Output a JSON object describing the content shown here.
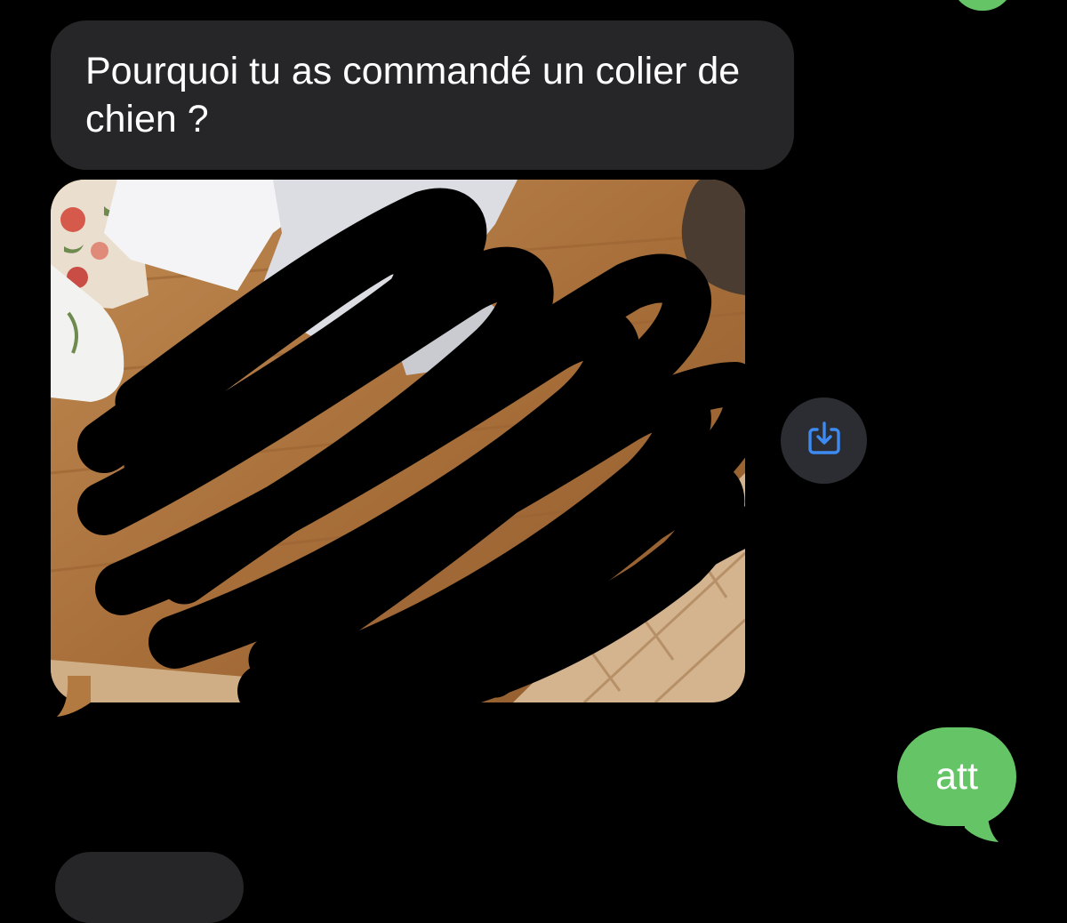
{
  "thread": {
    "incoming_message": "Pourquoi tu as commandé un colier de chien ?",
    "outgoing_message": "att"
  },
  "icons": {
    "save_button": "download-tray-icon"
  },
  "colors": {
    "background": "#000000",
    "incoming_bubble": "#262628",
    "outgoing_bubble": "#65c466",
    "accent_blue": "#3d8bf2"
  }
}
